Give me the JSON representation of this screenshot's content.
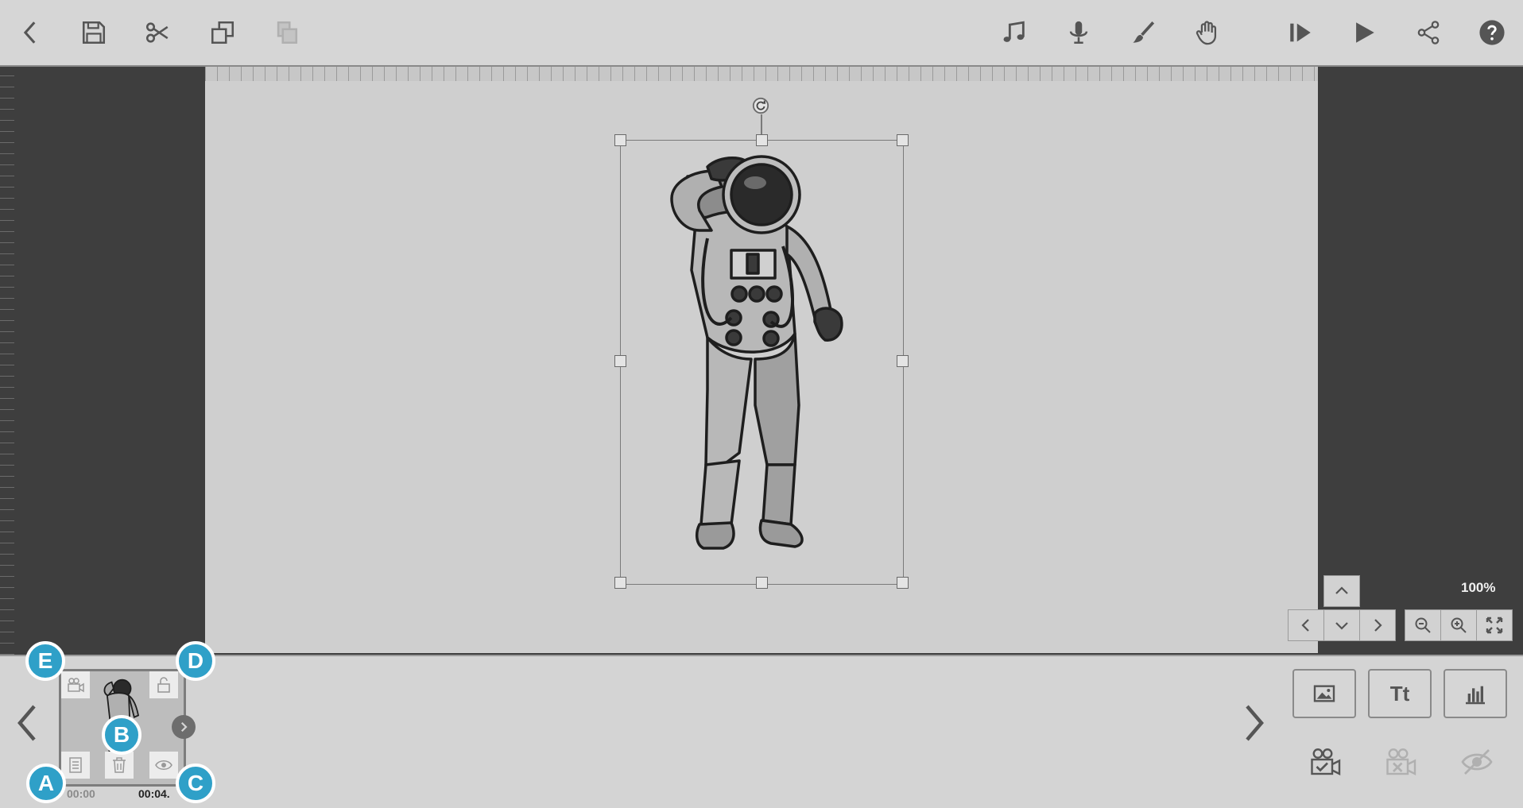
{
  "toolbar": {
    "left_tools": [
      {
        "name": "back",
        "icon": "chevron-left-icon"
      },
      {
        "name": "save",
        "icon": "save-icon"
      },
      {
        "name": "cut",
        "icon": "scissors-icon"
      },
      {
        "name": "copy",
        "icon": "copy-icon"
      },
      {
        "name": "paste",
        "icon": "paste-icon",
        "disabled": true
      }
    ],
    "right_tools": [
      {
        "name": "music",
        "icon": "music-note-icon"
      },
      {
        "name": "record",
        "icon": "microphone-icon"
      },
      {
        "name": "draw",
        "icon": "brush-icon"
      },
      {
        "name": "pan",
        "icon": "hand-icon"
      },
      {
        "name": "play-from-start",
        "icon": "play-from-start-icon"
      },
      {
        "name": "play",
        "icon": "play-icon"
      },
      {
        "name": "share",
        "icon": "share-icon"
      },
      {
        "name": "help",
        "icon": "help-icon"
      }
    ]
  },
  "stage": {
    "object": "astronaut-image",
    "zoom_label": "100%"
  },
  "timeline": {
    "scene": {
      "time_start": "00:00",
      "time_end": "00:04."
    },
    "callouts": [
      "A",
      "B",
      "C",
      "D",
      "E"
    ]
  },
  "add_tools": {
    "text_label": "Tt"
  },
  "colors": {
    "toolbar_bg": "#d6d6d6",
    "workspace_bg": "#3e3e3e",
    "canvas_bg": "#cfcfcf",
    "callout": "#2fa0c8"
  }
}
